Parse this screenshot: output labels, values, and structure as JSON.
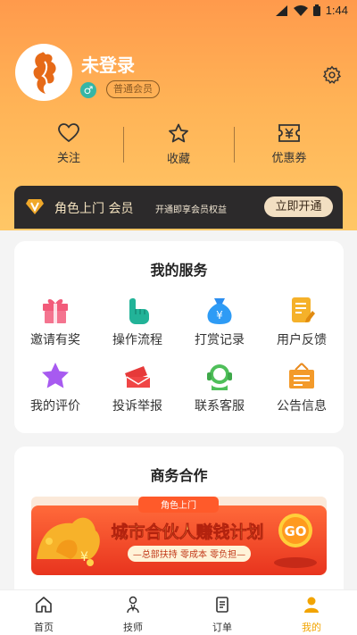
{
  "status": {
    "time": "1:44"
  },
  "profile": {
    "name": "未登录",
    "gender_symbol": "♂",
    "member_level": "普通会员"
  },
  "stats": [
    {
      "label": "关注"
    },
    {
      "label": "收藏"
    },
    {
      "label": "优惠券"
    }
  ],
  "vip": {
    "title": "角色上门 会员",
    "subtitle": "开通即享会员权益",
    "button": "立即开通"
  },
  "services": {
    "title": "我的服务",
    "items": [
      {
        "label": "邀请有奖",
        "icon": "gift-icon"
      },
      {
        "label": "操作流程",
        "icon": "pointer-hand-icon"
      },
      {
        "label": "打赏记录",
        "icon": "money-bag-icon"
      },
      {
        "label": "用户反馈",
        "icon": "feedback-note-icon"
      },
      {
        "label": "我的评价",
        "icon": "star-icon"
      },
      {
        "label": "投诉举报",
        "icon": "complaint-envelope-icon"
      },
      {
        "label": "联系客服",
        "icon": "customer-service-icon"
      },
      {
        "label": "公告信息",
        "icon": "announcement-board-icon"
      }
    ]
  },
  "business": {
    "title": "商务合作",
    "banner": {
      "tag": "角色上门",
      "headline": "城市合伙人赚钱计划",
      "points": "—总部扶持  零成本  零负担—",
      "cta": "GO"
    }
  },
  "tabs": [
    {
      "label": "首页",
      "icon": "home-icon",
      "active": false
    },
    {
      "label": "技师",
      "icon": "technician-icon",
      "active": false
    },
    {
      "label": "订单",
      "icon": "order-icon",
      "active": false
    },
    {
      "label": "我的",
      "icon": "profile-icon",
      "active": true
    }
  ],
  "colors": {
    "accent": "#f2a400",
    "header_top": "#ff9a4c",
    "header_bottom": "#ffc766",
    "vip_bar": "#2c2a2b"
  }
}
